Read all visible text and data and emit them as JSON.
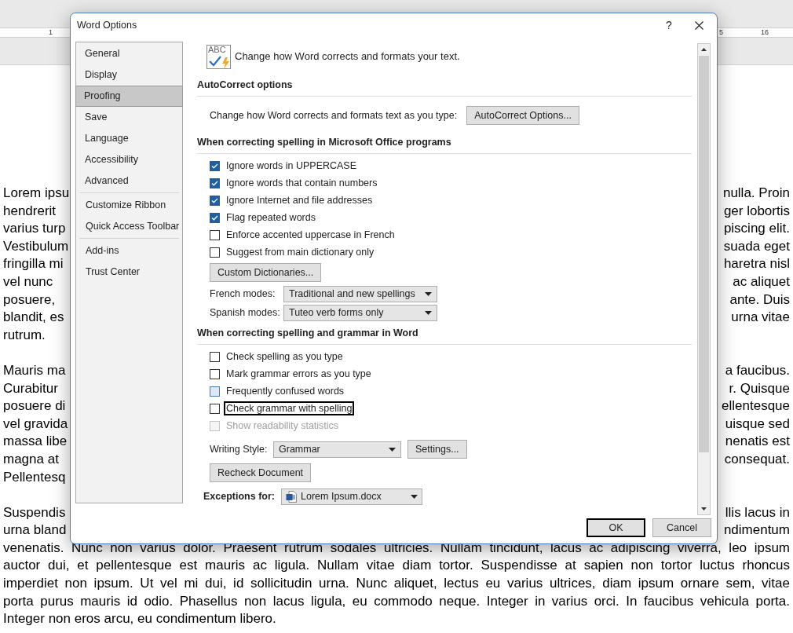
{
  "ruler": {
    "labels": [
      "1",
      "5",
      "16"
    ]
  },
  "document": {
    "paragraphs": [
      {
        "lines": [
          {
            "left": "Lorem ipsu",
            "right": "nulla. Proin"
          },
          {
            "left": "hendrerit",
            "right": "ger lobortis"
          },
          {
            "left": "varius turp",
            "right": "piscing elit."
          },
          {
            "left": "Vestibulum",
            "right": "suada eget"
          },
          {
            "left": "fringilla mi",
            "right": "haretra nisl"
          },
          {
            "left": "vel nunc",
            "right": "ac aliquet"
          },
          {
            "left": "posuere,",
            "right": "ante. Duis"
          },
          {
            "left": "blandit, es",
            "right": "urna vitae"
          },
          {
            "left": "rutrum."
          }
        ]
      },
      {
        "lines": [
          {
            "left": "Mauris ma",
            "right": "a faucibus."
          },
          {
            "left": "Curabitur",
            "right": "r. Quisque"
          },
          {
            "left": "posuere di",
            "right": "ellentesque"
          },
          {
            "left": "vel gravida",
            "right": "uisque sed"
          },
          {
            "left": "massa libe",
            "right": "nenatis est"
          },
          {
            "left": "magna at",
            "right": "consequat."
          },
          {
            "left": "Pellentesq"
          }
        ]
      },
      {
        "lines": [
          {
            "left": "Suspendis",
            "right": "llis lacus in"
          },
          {
            "left": "urna bland",
            "right": "ndimentum"
          },
          {
            "text": "venenatis. Nunc non varius dolor. Praesent rutrum sodales ultricies. Nullam tincidunt, lacus ac adipiscing viverra, leo ipsum"
          },
          {
            "text": "auctor dui, et pellentesque est mauris ac ligula. Nullam vitae diam tortor. Suspendisse at sapien non tortor luctus rhoncus"
          },
          {
            "text": "imperdiet non ipsum. Ut vel mi dui, id sollicitudin urna. Nunc aliquet, lectus eu varius ultrices, diam ipsum ornare sem, vitae"
          },
          {
            "text": "porta purus mauris id odio. Phasellus non lacus ligula, eu commodo neque. Integer in varius orci. In faucibus vehicula porta."
          },
          {
            "text": "Integer non eros arcu, eu condimentum libero."
          }
        ]
      }
    ]
  },
  "dialog": {
    "title": "Word Options",
    "help": "?",
    "nav": [
      [
        {
          "label": "General",
          "selected": false
        },
        {
          "label": "Display",
          "selected": false
        },
        {
          "label": "Proofing",
          "selected": true
        },
        {
          "label": "Save",
          "selected": false
        },
        {
          "label": "Language",
          "selected": false
        },
        {
          "label": "Accessibility",
          "selected": false
        },
        {
          "label": "Advanced",
          "selected": false
        }
      ],
      [
        {
          "label": "Customize Ribbon",
          "selected": false
        },
        {
          "label": "Quick Access Toolbar",
          "selected": false
        }
      ],
      [
        {
          "label": "Add-ins",
          "selected": false
        },
        {
          "label": "Trust Center",
          "selected": false
        }
      ]
    ],
    "header": {
      "icon_text": "ABC",
      "text": "Change how Word corrects and formats your text."
    },
    "sections": [
      {
        "title": "AutoCorrect options",
        "rows": [
          {
            "kind": "labeled_button",
            "label": "Change how Word corrects and formats text as you type:",
            "button": "AutoCorrect Options..."
          }
        ]
      },
      {
        "title": "When correcting spelling in Microsoft Office programs",
        "rows": [
          {
            "kind": "checkbox",
            "label": "Ignore words in UPPERCASE",
            "checked": true,
            "hovered": false,
            "focused": false,
            "disabled": false
          },
          {
            "kind": "checkbox",
            "label": "Ignore words that contain numbers",
            "checked": true,
            "hovered": false,
            "focused": false,
            "disabled": false
          },
          {
            "kind": "checkbox",
            "label": "Ignore Internet and file addresses",
            "checked": true,
            "hovered": false,
            "focused": false,
            "disabled": false
          },
          {
            "kind": "checkbox",
            "label": "Flag repeated words",
            "checked": true,
            "hovered": false,
            "focused": false,
            "disabled": false
          },
          {
            "kind": "checkbox",
            "label": "Enforce accented uppercase in French",
            "checked": false,
            "hovered": false,
            "focused": false,
            "disabled": false
          },
          {
            "kind": "checkbox",
            "label": "Suggest from main dictionary only",
            "checked": false,
            "hovered": false,
            "focused": false,
            "disabled": false
          },
          {
            "kind": "button",
            "label": "Custom Dictionaries..."
          },
          {
            "kind": "dropdown",
            "label": "French modes:",
            "value": "Traditional and new spellings"
          },
          {
            "kind": "dropdown",
            "label": "Spanish modes:",
            "value": "Tuteo verb forms only"
          }
        ]
      },
      {
        "title": "When correcting spelling and grammar in Word",
        "rows": [
          {
            "kind": "checkbox",
            "label": "Check spelling as you type",
            "checked": false,
            "hovered": false,
            "focused": false,
            "disabled": false
          },
          {
            "kind": "checkbox",
            "label": "Mark grammar errors as you type",
            "checked": false,
            "hovered": false,
            "focused": false,
            "disabled": false
          },
          {
            "kind": "checkbox",
            "label": "Frequently confused words",
            "checked": false,
            "hovered": true,
            "focused": false,
            "disabled": false
          },
          {
            "kind": "checkbox",
            "label": "Check grammar with spelling",
            "checked": false,
            "hovered": false,
            "focused": true,
            "disabled": false
          },
          {
            "kind": "checkbox",
            "label": "Show readability statistics",
            "checked": false,
            "hovered": false,
            "focused": false,
            "disabled": true
          },
          {
            "kind": "dropdown",
            "label": "Writing Style:",
            "value": "Grammar",
            "button": "Settings..."
          },
          {
            "kind": "button",
            "label": "Recheck Document"
          },
          {
            "kind": "file_dropdown",
            "label": "Exceptions for:",
            "value": "Lorem Ipsum.docx"
          }
        ]
      }
    ],
    "buttons": [
      {
        "label": "OK",
        "default": true
      },
      {
        "label": "Cancel",
        "default": false
      }
    ]
  }
}
